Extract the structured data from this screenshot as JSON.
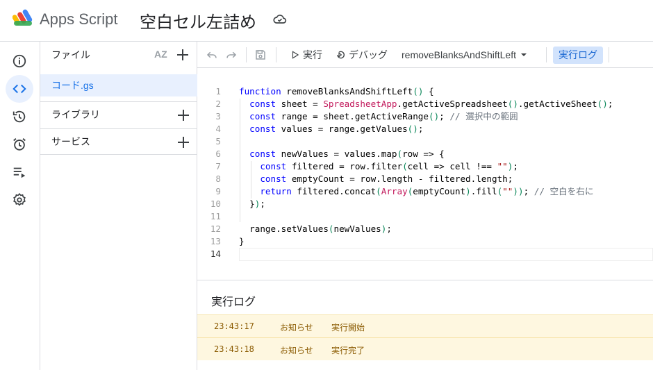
{
  "header": {
    "app_name": "Apps Script",
    "project_title": "空白セル左詰め"
  },
  "rail": {
    "items": [
      {
        "name": "overview",
        "icon": "info-icon"
      },
      {
        "name": "editor",
        "icon": "code-icon",
        "active": true
      },
      {
        "name": "executions",
        "icon": "history-icon"
      },
      {
        "name": "triggers",
        "icon": "alarm-icon"
      },
      {
        "name": "executions-list",
        "icon": "list-run-icon"
      },
      {
        "name": "settings",
        "icon": "gear-icon"
      }
    ]
  },
  "files": {
    "header": "ファイル",
    "sort_label": "AZ",
    "items": [
      "コード.gs"
    ],
    "libraries": "ライブラリ",
    "services": "サービス"
  },
  "toolbar": {
    "run": "実行",
    "debug": "デバッグ",
    "function_select": "removeBlanksAndShiftLeft",
    "log_button": "実行ログ"
  },
  "code": {
    "line_numbers": [
      "1",
      "2",
      "3",
      "4",
      "5",
      "6",
      "7",
      "8",
      "9",
      "10",
      "11",
      "12",
      "13",
      "14"
    ]
  },
  "log": {
    "title": "実行ログ",
    "entries": [
      {
        "time": "23:43:17",
        "level": "お知らせ",
        "message": "実行開始"
      },
      {
        "time": "23:43:18",
        "level": "お知らせ",
        "message": "実行完了"
      }
    ]
  },
  "colors": {
    "accent": "#1a73e8",
    "active_bg": "#e8f0fe",
    "log_bg": "#fef7e0"
  }
}
